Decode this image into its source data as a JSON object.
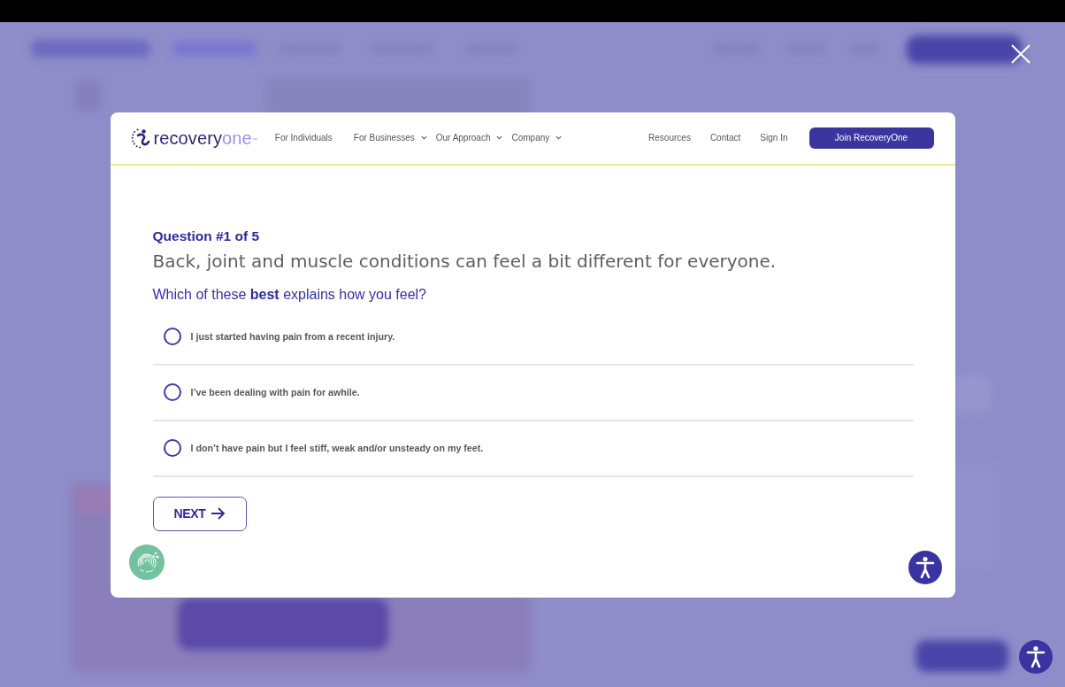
{
  "site_header": {
    "logo": {
      "wordmark_dark": "recovery",
      "wordmark_light": "one",
      "trademark": "™"
    },
    "nav_items": [
      {
        "label": "For Individuals",
        "has_menu": false
      },
      {
        "label": "For Businesses",
        "has_menu": true
      },
      {
        "label": "Our Approach",
        "has_menu": true
      },
      {
        "label": "Company",
        "has_menu": true
      }
    ],
    "utility_links": [
      "Resources",
      "Contact",
      "Sign In"
    ],
    "cta_button": "Join RecoveryOne"
  },
  "quiz": {
    "progress": "Question #1 of 5",
    "statement": "Back, joint and muscle conditions can feel a bit different for everyone.",
    "prompt": "Which of these **best** explains how you feel?",
    "options": [
      {
        "label": "I just started having pain from a recent injury.",
        "selected": false
      },
      {
        "label": "I’ve been dealing with pain for awhile.",
        "selected": false
      },
      {
        "label": "I don’t have pain but I feel stiff, weak and/or unsteady on my feet.",
        "selected": false
      }
    ],
    "next_button": "NEXT"
  }
}
